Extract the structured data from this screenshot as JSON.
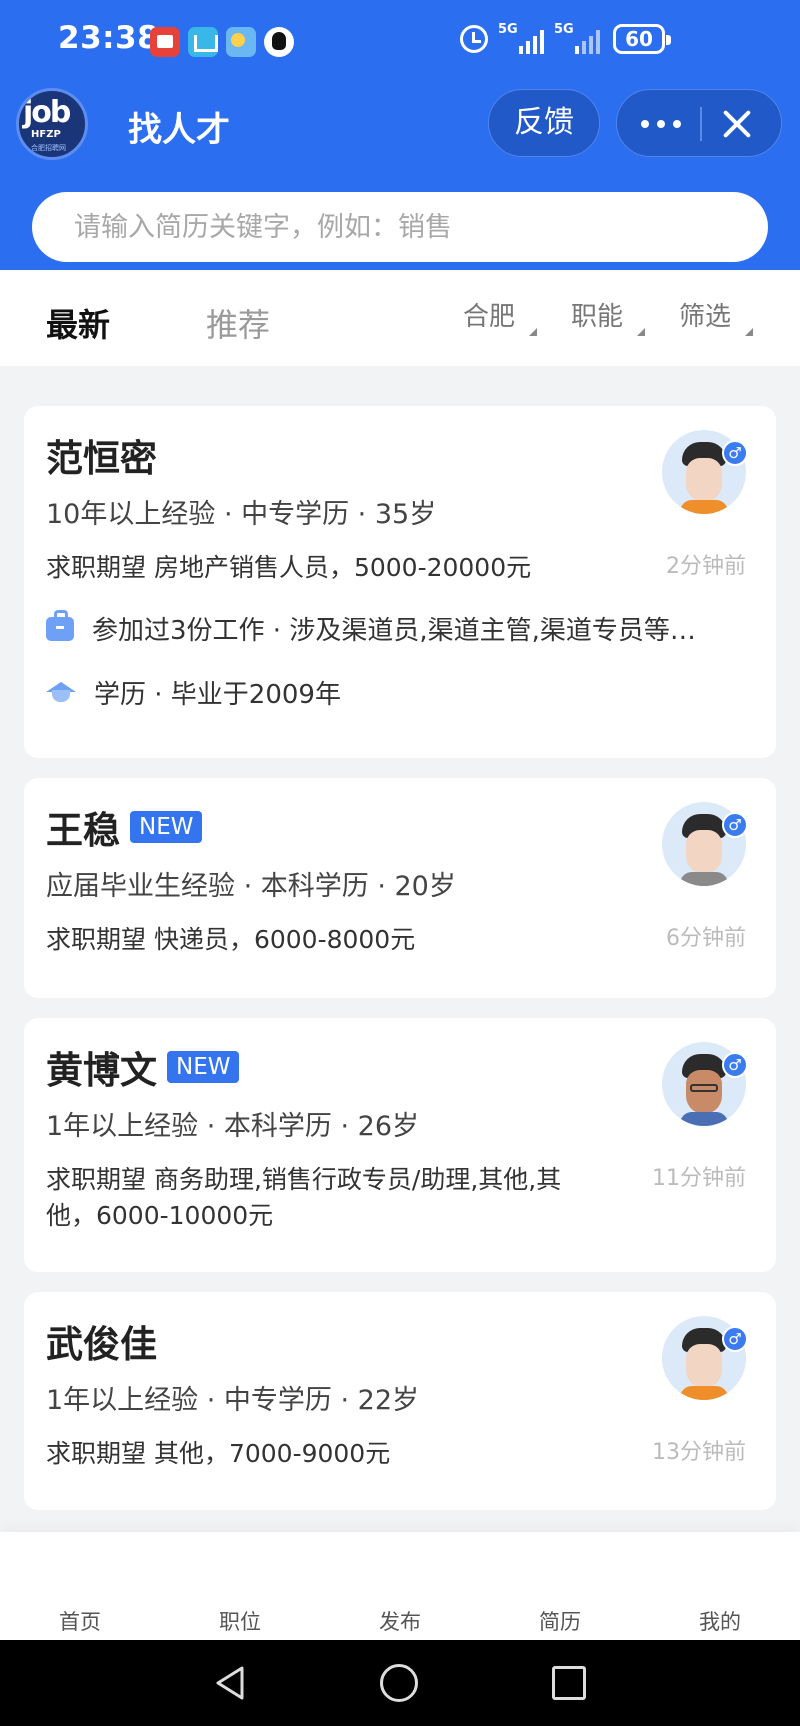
{
  "status_bar": {
    "time": "23:38",
    "network_1": "5G",
    "network_2": "5G",
    "battery": "60"
  },
  "app_bar": {
    "logo_main": "job",
    "logo_sub": "HFZP",
    "logo_tiny": "合肥招聘网",
    "title": "找人才",
    "feedback_label": "反馈"
  },
  "search": {
    "placeholder": "请输入简历关键字，例如：销售"
  },
  "tabs": {
    "latest": "最新",
    "recommended": "推荐"
  },
  "filters": {
    "city": "合肥",
    "function": "职能",
    "screen": "筛选"
  },
  "candidates": [
    {
      "name": "范恒密",
      "is_new": false,
      "meta": "10年以上经验 · 中专学历 · 35岁",
      "expectation": "求职期望 房地产销售人员，5000-20000元",
      "time_ago": "2分钟前",
      "work_history": "参加过3份工作 · 涉及渠道员,渠道主管,渠道专员等…",
      "education": "学历 · 毕业于2009年",
      "gender_symbol": "♂"
    },
    {
      "name": "王稳",
      "is_new": true,
      "badge": "NEW",
      "meta": "应届毕业生经验 · 本科学历 · 20岁",
      "expectation": "求职期望 快递员，6000-8000元",
      "time_ago": "6分钟前",
      "gender_symbol": "♂"
    },
    {
      "name": "黄博文",
      "is_new": true,
      "badge": "NEW",
      "meta": "1年以上经验 · 本科学历 · 26岁",
      "expectation": "求职期望 商务助理,销售行政专员/助理,其他,其他，6000-10000元",
      "time_ago": "11分钟前",
      "gender_symbol": "♂"
    },
    {
      "name": "武俊佳",
      "is_new": false,
      "meta": "1年以上经验 · 中专学历 · 22岁",
      "expectation": "求职期望 其他，7000-9000元",
      "time_ago": "13分钟前",
      "gender_symbol": "♂"
    }
  ],
  "bottom_nav": [
    "首页",
    "职位",
    "发布",
    "简历",
    "我的"
  ],
  "colors": {
    "brand_blue": "#2b6ef0",
    "badge_blue": "#3474ee",
    "page_bg": "#f2f3f5"
  }
}
